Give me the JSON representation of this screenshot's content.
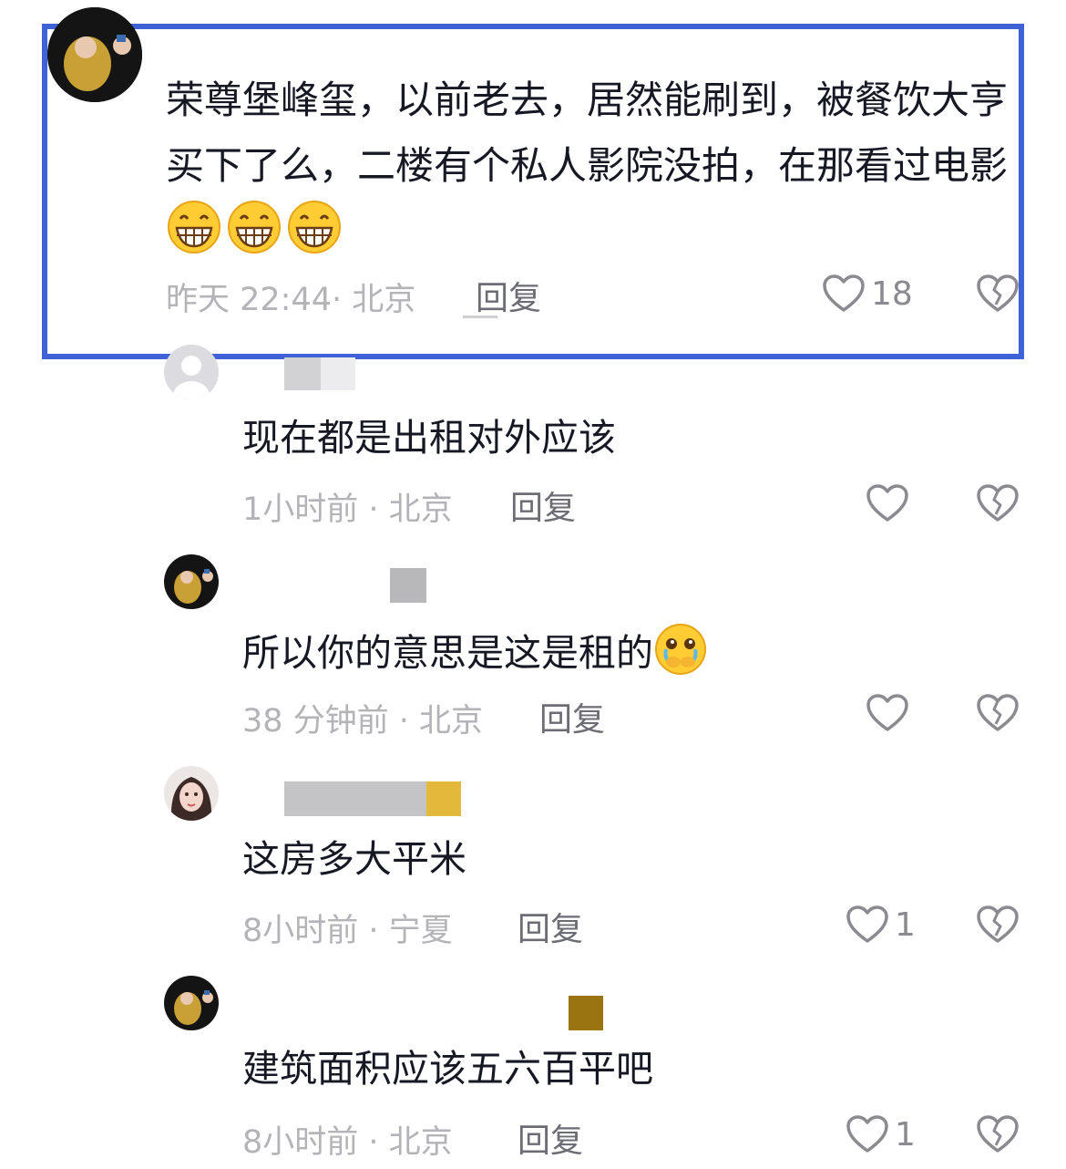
{
  "main_comment": {
    "text": "荣尊堡峰玺，以前老去，居然能刷到，被餐饮大亨买下了么，二楼有个私人影院没拍，在那看过电影",
    "emojis": [
      "grinning-face-emoji",
      "grinning-face-emoji",
      "grinning-face-emoji"
    ],
    "meta": "昨天 22:44· 北京",
    "reply_label": "回复",
    "likes": "18"
  },
  "replies": [
    {
      "text": "现在都是出租对外应该",
      "meta": "1小时前 · 北京",
      "reply_label": "回复",
      "likes": ""
    },
    {
      "text": "所以你的意思是这是租的",
      "emoji": "crying-face-emoji",
      "meta": "38 分钟前 · 北京",
      "reply_label": "回复",
      "likes": ""
    },
    {
      "text": "这房多大平米",
      "meta": "8小时前 · 宁夏",
      "reply_label": "回复",
      "likes": "1"
    },
    {
      "text": "建筑面积应该五六百平吧",
      "meta": "8小时前 · 北京",
      "reply_label": "回复",
      "likes": "1"
    }
  ],
  "icons": {
    "like": "heart-icon",
    "dislike": "broken-heart-icon"
  },
  "colors": {
    "highlight_border": "#3f63d6",
    "meta_text": "#b3b3b8",
    "body_text": "#161823"
  }
}
